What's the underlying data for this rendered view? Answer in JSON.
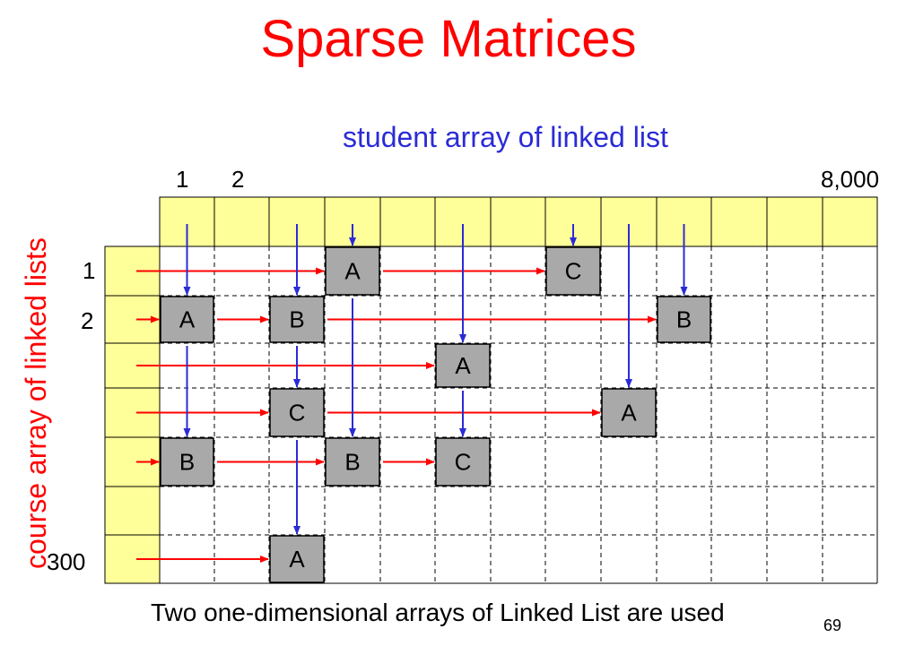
{
  "title": "Sparse Matrices",
  "student_label": "student array of linked list",
  "course_label": "course array of linked lists",
  "column_labels": {
    "first": "1",
    "second": "2",
    "last": "8,000"
  },
  "row_labels": {
    "first": "1",
    "second": "2",
    "last": "300"
  },
  "caption": "Two one-dimensional arrays of Linked List are used",
  "page_number": "69",
  "colors": {
    "header_fill": "#ffff99",
    "node_fill": "#a9a9a9",
    "row_arrow": "#ff0000",
    "column_arrow": "#2b2bd6",
    "title": "#ff0000"
  },
  "nodes": [
    {
      "row": 1,
      "col": 5,
      "label": "A"
    },
    {
      "row": 1,
      "col": 9,
      "label": "C"
    },
    {
      "row": 2,
      "col": 2,
      "label": "A"
    },
    {
      "row": 2,
      "col": 4,
      "label": "B"
    },
    {
      "row": 2,
      "col": 11,
      "label": "B"
    },
    {
      "row": 3,
      "col": 7,
      "label": "A"
    },
    {
      "row": 4,
      "col": 4,
      "label": "C"
    },
    {
      "row": 4,
      "col": 10,
      "label": "A"
    },
    {
      "row": 5,
      "col": 2,
      "label": "B"
    },
    {
      "row": 5,
      "col": 5,
      "label": "B"
    },
    {
      "row": 5,
      "col": 7,
      "label": "C"
    },
    {
      "row": 7,
      "col": 4,
      "label": "A"
    }
  ]
}
